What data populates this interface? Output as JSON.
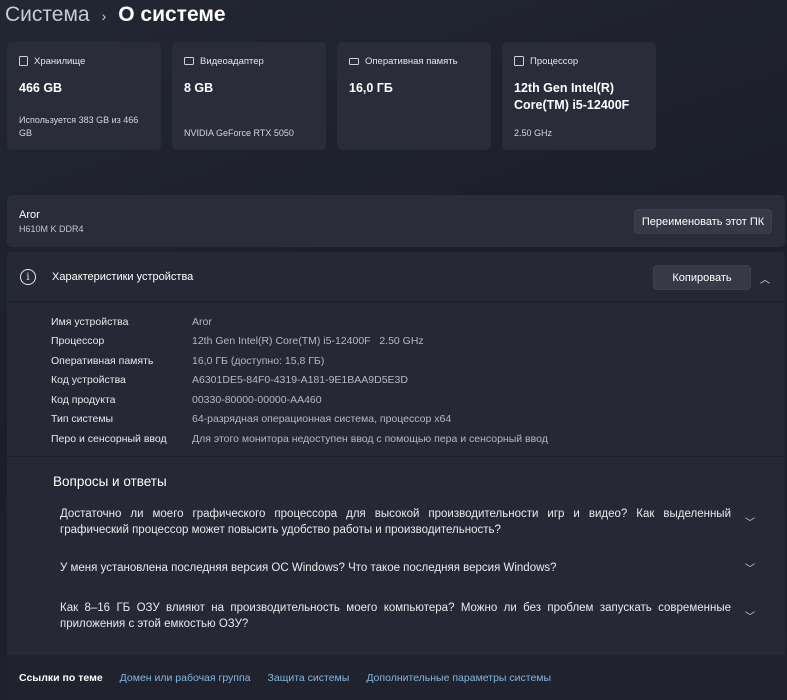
{
  "breadcrumb": {
    "parent": "Система",
    "separator": "›",
    "current": "О системе"
  },
  "cards": [
    {
      "icon": "storage-icon",
      "label": "Хранилище",
      "value": "466 GB",
      "sub": "Используется 383 GB из 466 GB"
    },
    {
      "icon": "display-adapter-icon",
      "label": "Видеоадаптер",
      "value": "8 GB",
      "sub": "NVIDIA GeForce RTX 5050"
    },
    {
      "icon": "memory-icon",
      "label": "Оперативная память",
      "value": "16,0 ГБ",
      "sub": ""
    },
    {
      "icon": "processor-icon",
      "label": "Процессор",
      "value": "12th Gen Intel(R) Core(TM) i5-12400F",
      "sub": "2.50 GHz"
    }
  ],
  "device": {
    "name": "Aror",
    "model": "H610M K DDR4",
    "rename_label": "Переименовать этот ПК"
  },
  "specs": {
    "title": "Характеристики устройства",
    "copy_label": "Копировать",
    "rows": [
      {
        "key": "Имя устройства",
        "value": "Aror"
      },
      {
        "key": "Процессор",
        "value": "12th Gen Intel(R) Core(TM) i5-12400F   2.50 GHz"
      },
      {
        "key": "Оперативная память",
        "value": "16,0 ГБ (доступно: 15,8 ГБ)"
      },
      {
        "key": "Код устройства",
        "value": "A6301DE5-84F0-4319-A181-9E1BAA9D5E3D"
      },
      {
        "key": "Код продукта",
        "value": "00330-80000-00000-AA460"
      },
      {
        "key": "Тип системы",
        "value": "64-разрядная операционная система, процессор x64"
      },
      {
        "key": "Перо и сенсорный ввод",
        "value": "Для этого монитора недоступен ввод с помощью пера и сенсорный ввод"
      }
    ]
  },
  "faq": {
    "title": "Вопросы и ответы",
    "items": [
      "Достаточно ли моего графического процессора для высокой производительности игр и видео? Как выделенный графический процессор может повысить удобство работы и производительность?",
      "У меня установлена последняя версия ОС Windows? Что такое последняя версия Windows?",
      "Как 8–16 ГБ ОЗУ влияют на производительность моего компьютера? Можно ли без проблем запускать современные приложения с этой емкостью ОЗУ?"
    ]
  },
  "related_links": {
    "label": "Ссылки по теме",
    "items": [
      "Домен или рабочая группа",
      "Защита системы",
      "Дополнительные параметры системы"
    ]
  }
}
